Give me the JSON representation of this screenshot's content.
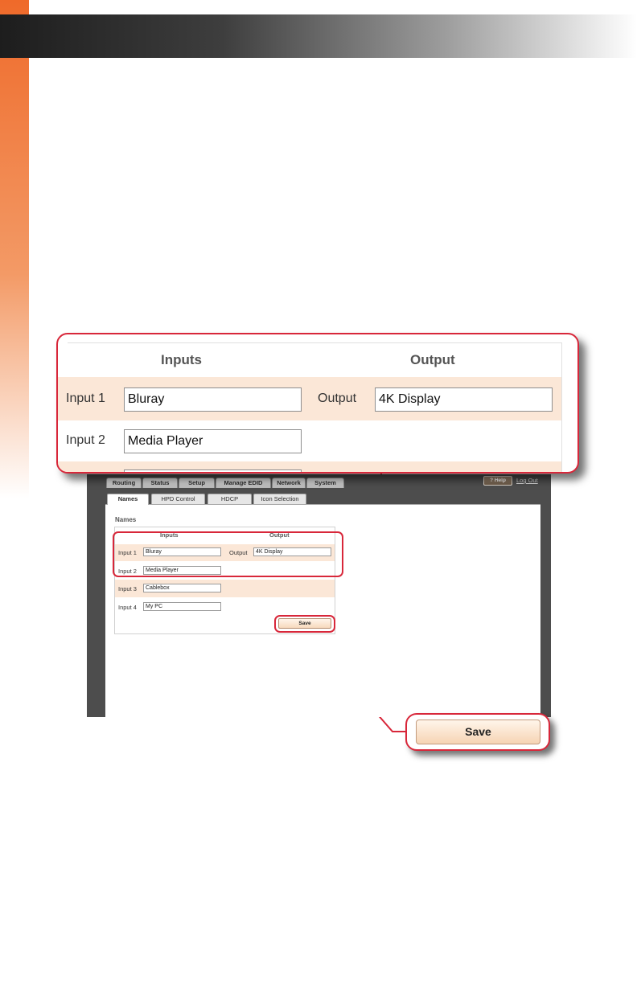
{
  "callout": {
    "inputs_header": "Inputs",
    "output_header": "Output",
    "rows": [
      {
        "label": "Input 1",
        "value": "Bluray",
        "output_label": "Output",
        "output_value": "4K Display"
      },
      {
        "label": "Input 2",
        "value": "Media Player"
      }
    ]
  },
  "tabs": [
    "Routing",
    "Status",
    "Setup",
    "Manage EDID",
    "Network",
    "System"
  ],
  "help_label": "? Help",
  "logout_label": "Log Out",
  "subtabs": [
    "Names",
    "HPD Control",
    "HDCP",
    "Icon Selection"
  ],
  "section_title": "Names",
  "names_form": {
    "inputs_header": "Inputs",
    "output_header": "Output",
    "rows": [
      {
        "label": "Input 1",
        "value": "Bluray",
        "output_label": "Output",
        "output_value": "4K Display"
      },
      {
        "label": "Input 2",
        "value": "Media Player"
      },
      {
        "label": "Input 3",
        "value": "Cablebox"
      },
      {
        "label": "Input 4",
        "value": "My PC"
      }
    ],
    "save_label": "Save"
  },
  "save_callout_label": "Save",
  "colors": {
    "accent": "#d8273a",
    "side_bar": "#ef6a2a",
    "row_band": "#fbe7d7"
  }
}
